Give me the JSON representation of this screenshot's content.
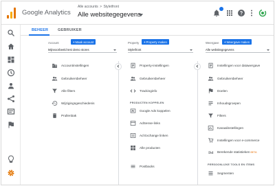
{
  "header": {
    "app_name": "Google Analytics",
    "breadcrumb_account": "Alle accounts",
    "breadcrumb_separator": ">",
    "breadcrumb_property": "Styletfront",
    "view_title": "Alle websitegegevens",
    "icons": [
      "notifications-icon",
      "apps-icon",
      "help-icon",
      "more-vert-icon",
      "account-icon"
    ]
  },
  "tabs": [
    {
      "label": "BEHEER",
      "active": true
    },
    {
      "label": "GEBRUIKER",
      "active": false
    }
  ],
  "account": {
    "label": "Account",
    "create_label": "Maak account",
    "select_value": "Mijnvoorbeeld test demo stores",
    "items": [
      {
        "label": "Accountinstellingen",
        "icon": "building-icon"
      },
      {
        "label": "Gebruikersbeheer",
        "icon": "people-icon"
      },
      {
        "label": "Alle filters",
        "icon": "filter-icon"
      },
      {
        "label": "Wijzigingsgeschiedenis",
        "icon": "history-icon"
      },
      {
        "label": "Prullenbak",
        "icon": "trash-icon"
      }
    ]
  },
  "property": {
    "label": "Property",
    "create_label": "Property maken",
    "select_value": "Styletfront",
    "items": [
      {
        "label": "Property-instellingen",
        "icon": "page-icon"
      },
      {
        "label": "Gebruikersbeheer",
        "icon": "people-icon"
      },
      {
        "label": "Trackinginfo",
        "icon": "code-icon"
      }
    ],
    "section_title": "PRODUCTEN KOPPELEN",
    "product_items": [
      {
        "label": "Google Ads koppelen",
        "icon": "ads-icon"
      },
      {
        "label": "AdSense-links",
        "icon": "adsense-icon"
      },
      {
        "label": "Ad Exchange linken",
        "icon": "adexchange-icon"
      },
      {
        "label": "Alle producten",
        "icon": "grid-icon"
      }
    ],
    "extra_items": [
      {
        "label": "Postbacks",
        "icon": "postbacks-icon"
      }
    ]
  },
  "view": {
    "label": "Weergave",
    "create_label": "Weergave maken",
    "select_value": "Alle websitegegevens",
    "items": [
      {
        "label": "Instellingen voor datawergave",
        "icon": "page-icon"
      },
      {
        "label": "Gebruikersbeheer",
        "icon": "people-icon"
      },
      {
        "label": "Doelen",
        "icon": "flag-icon"
      },
      {
        "label": "Inhoudsgroepen",
        "icon": "content-icon"
      },
      {
        "label": "Filters",
        "icon": "filter-icon"
      },
      {
        "label": "Kanaalinstellingen",
        "icon": "channel-icon"
      },
      {
        "label": "Instellingen voor e-commerce",
        "icon": "cart-icon"
      },
      {
        "label": "Berekende statistieken",
        "icon": "calc-icon",
        "badge": "BETA"
      }
    ],
    "section_title": "PERSOONLIJKE TOOLS EN ITEMS",
    "tool_items": [
      {
        "label": "Segmenten",
        "icon": "segments-icon"
      }
    ]
  },
  "colors": {
    "accent": "#1a73e8",
    "logo_orange": "#e37400",
    "logo_yellow": "#f9ab00",
    "settings_active": "#e37400",
    "avatar_green": "#34a853"
  }
}
